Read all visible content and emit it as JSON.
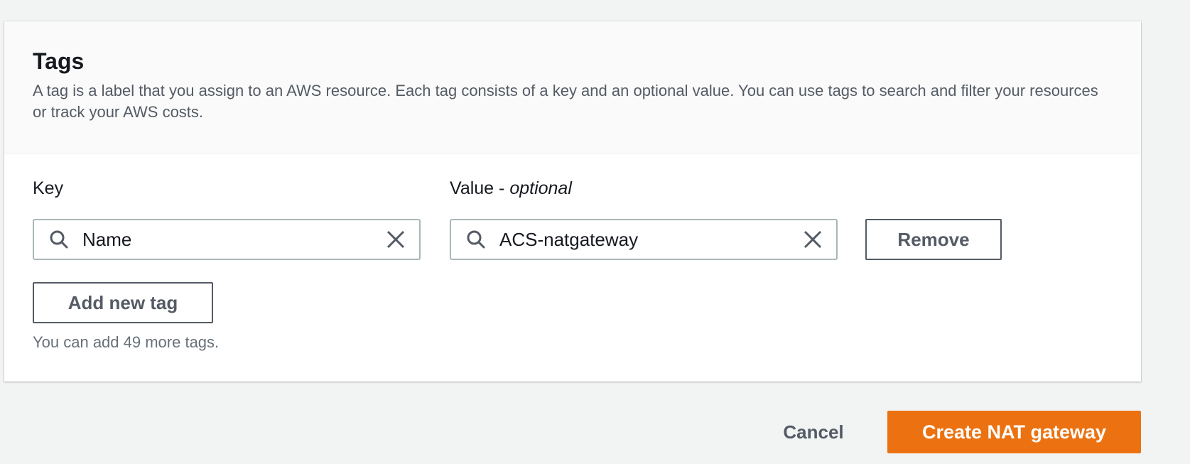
{
  "tags_panel": {
    "title": "Tags",
    "description": "A tag is a label that you assign to an AWS resource. Each tag consists of a key and an optional value. You can use tags to search and filter your resources or track your AWS costs."
  },
  "tag_row": {
    "key_label": "Key",
    "key_value": "Name",
    "value_label": "Value - ",
    "value_label_optional": "optional",
    "value_value": "ACS-natgateway",
    "remove_label": "Remove"
  },
  "add_tag": {
    "label": "Add new tag",
    "hint": "You can add 49 more tags."
  },
  "footer": {
    "cancel_label": "Cancel",
    "create_label": "Create NAT gateway"
  },
  "colors": {
    "primary": "#ec7211",
    "text": "#16191f",
    "secondary_text": "#545b64",
    "border": "#aab7b8",
    "page_bg": "#f2f3f3"
  },
  "icons": {
    "search": "search-icon",
    "clear": "close-icon"
  }
}
